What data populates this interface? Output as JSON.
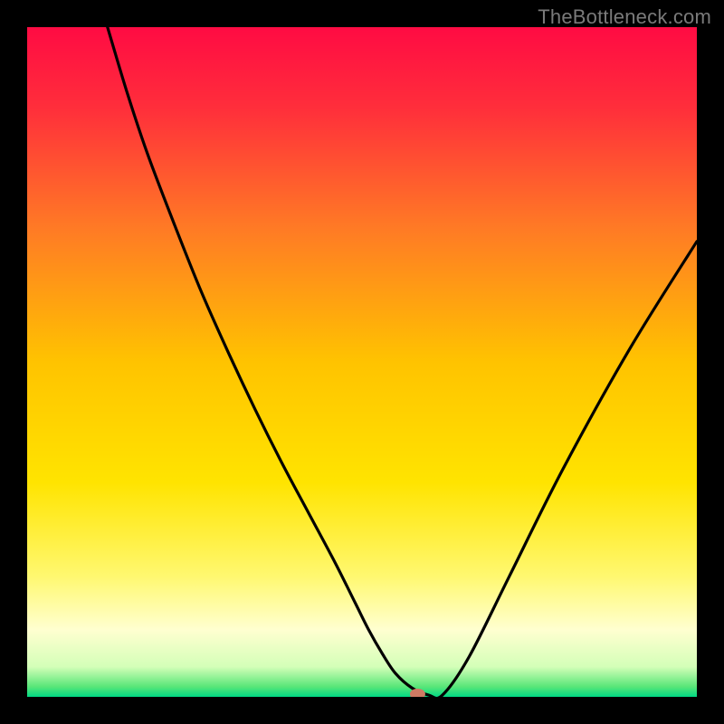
{
  "watermark": "TheBottleneck.com",
  "chart_data": {
    "type": "line",
    "title": "",
    "xlabel": "",
    "ylabel": "",
    "xlim": [
      0,
      100
    ],
    "ylim": [
      0,
      100
    ],
    "gradient_stops": [
      {
        "offset": 0.0,
        "color": "#ff0b43"
      },
      {
        "offset": 0.12,
        "color": "#ff2e3b"
      },
      {
        "offset": 0.3,
        "color": "#ff7a25"
      },
      {
        "offset": 0.5,
        "color": "#ffc300"
      },
      {
        "offset": 0.68,
        "color": "#ffe400"
      },
      {
        "offset": 0.82,
        "color": "#fff870"
      },
      {
        "offset": 0.9,
        "color": "#ffffd0"
      },
      {
        "offset": 0.955,
        "color": "#d4ffb8"
      },
      {
        "offset": 0.985,
        "color": "#58e678"
      },
      {
        "offset": 1.0,
        "color": "#00d984"
      }
    ],
    "series": [
      {
        "name": "bottleneck-curve",
        "color": "#000000",
        "width": 3.2,
        "x": [
          12,
          15,
          18,
          22,
          26,
          30,
          34,
          38,
          42,
          46,
          49,
          51,
          53,
          55,
          57.5,
          60,
          62,
          66,
          72,
          80,
          90,
          100
        ],
        "y": [
          100,
          90,
          81,
          70.5,
          60.5,
          51.5,
          43,
          35,
          27.5,
          20,
          14,
          10,
          6.5,
          3.5,
          1.3,
          0.25,
          0.25,
          6,
          18,
          34,
          52,
          68
        ]
      }
    ],
    "marker": {
      "name": "optimal-point",
      "x": 58.3,
      "y": 0.4,
      "rx": 8.5,
      "ry": 6.2,
      "fill": "#cf7a63"
    }
  }
}
